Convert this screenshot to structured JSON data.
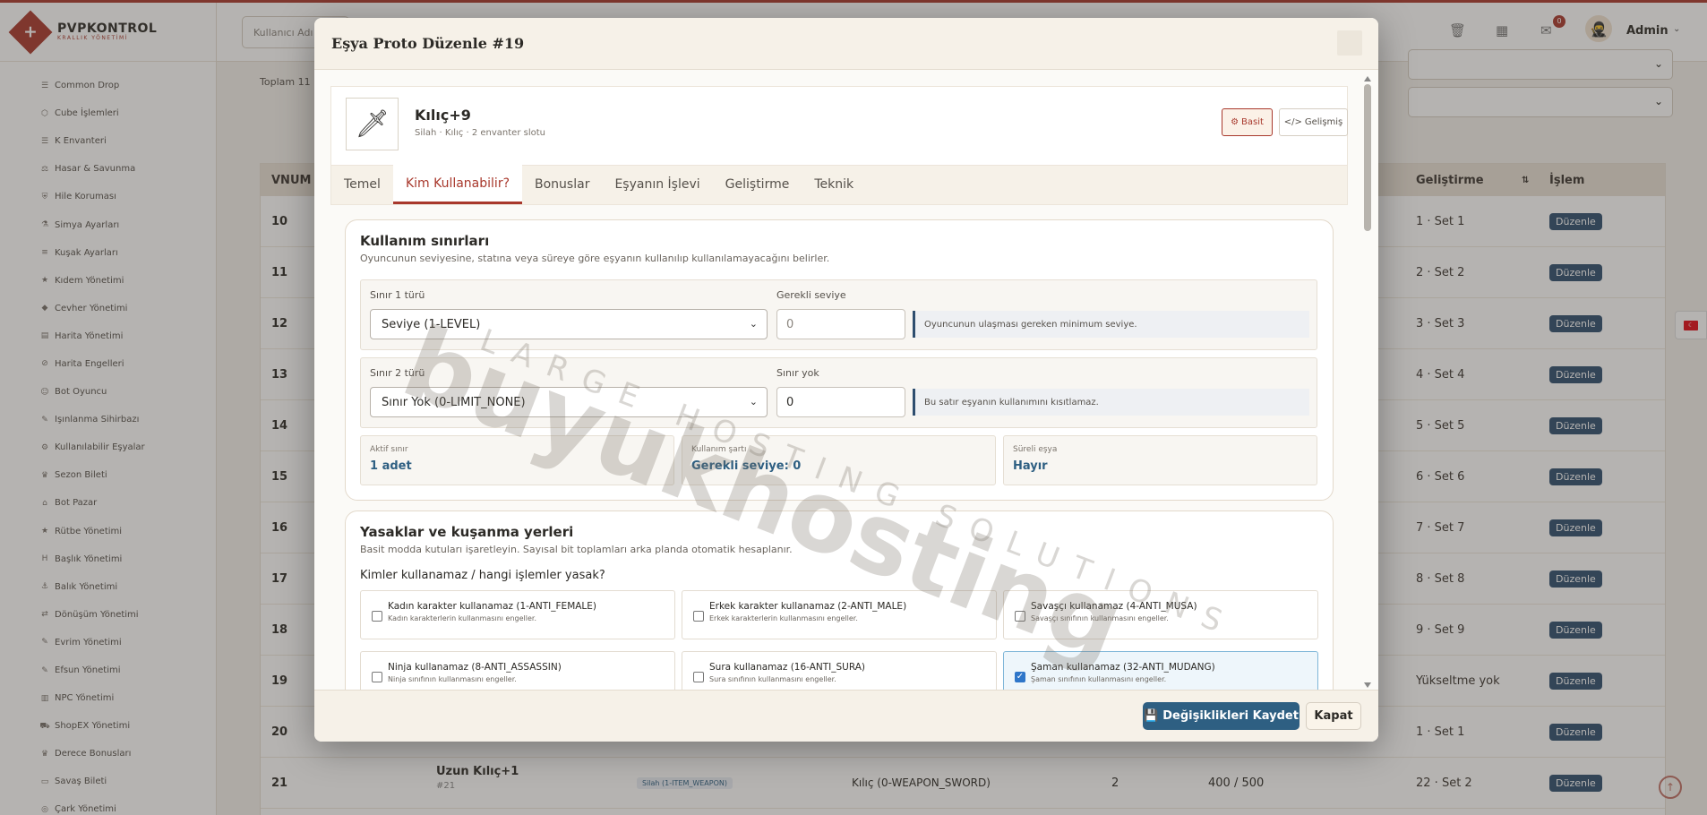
{
  "brand": {
    "title": "PVPKONTROL",
    "subtitle": "KRALLIK YÖNETİMİ",
    "logo_glyph": "+"
  },
  "sidebar": {
    "items": [
      {
        "label": "Common Drop",
        "icon": "list-icon"
      },
      {
        "label": "Cube İşlemleri",
        "icon": "cube-icon"
      },
      {
        "label": "K Envanteri",
        "icon": "list-icon"
      },
      {
        "label": "Hasar & Savunma",
        "icon": "scale-icon"
      },
      {
        "label": "Hile Koruması",
        "icon": "shield-icon"
      },
      {
        "label": "Simya Ayarları",
        "icon": "flask-icon"
      },
      {
        "label": "Kuşak Ayarları",
        "icon": "sliders-icon"
      },
      {
        "label": "Kıdem Yönetimi",
        "icon": "star-icon"
      },
      {
        "label": "Cevher Yönetimi",
        "icon": "gem-icon"
      },
      {
        "label": "Harita Yönetimi",
        "icon": "map-icon"
      },
      {
        "label": "Harita Engelleri",
        "icon": "ban-icon"
      },
      {
        "label": "Bot Oyuncu",
        "icon": "robot-icon"
      },
      {
        "label": "Işınlanma Sihirbazı",
        "icon": "wand-icon"
      },
      {
        "label": "Kullanılabilir Eşyalar",
        "icon": "gears-icon"
      },
      {
        "label": "Sezon Bileti",
        "icon": "trophy-icon"
      },
      {
        "label": "Bot Pazar",
        "icon": "store-icon"
      },
      {
        "label": "Rütbe Yönetimi",
        "icon": "star-icon"
      },
      {
        "label": "Başlık Yönetimi",
        "icon": "heading-icon"
      },
      {
        "label": "Balık Yönetimi",
        "icon": "anchor-icon"
      },
      {
        "label": "Dönüşüm Yönetimi",
        "icon": "shuffle-icon"
      },
      {
        "label": "Evrim Yönetimi",
        "icon": "wand-icon"
      },
      {
        "label": "Efsun Yönetimi",
        "icon": "wand-icon"
      },
      {
        "label": "NPC Yönetimi",
        "icon": "building-icon"
      },
      {
        "label": "ShopEX Yönetimi",
        "icon": "cart-icon"
      },
      {
        "label": "Derece Bonusları",
        "icon": "trophy-icon"
      },
      {
        "label": "Savaş Bileti",
        "icon": "ticket-icon"
      },
      {
        "label": "Çark Yönetimi",
        "icon": "wheel-icon"
      }
    ]
  },
  "topbar": {
    "search_placeholder": "Kullanıcı Adı",
    "notification_count": "0",
    "user_name": "Admin"
  },
  "background": {
    "total_text": "Toplam 11",
    "table_headers": {
      "vnum": "VNUM",
      "gelistirme": "Geliştirme",
      "islem": "İşlem"
    },
    "rows": [
      {
        "vnum": "10",
        "set": "1 · Set 1",
        "edit": "Düzenle"
      },
      {
        "vnum": "11",
        "set": "2 · Set 2",
        "edit": "Düzenle"
      },
      {
        "vnum": "12",
        "set": "3 · Set 3",
        "edit": "Düzenle"
      },
      {
        "vnum": "13",
        "set": "4 · Set 4",
        "edit": "Düzenle"
      },
      {
        "vnum": "14",
        "set": "5 · Set 5",
        "edit": "Düzenle"
      },
      {
        "vnum": "15",
        "set": "6 · Set 6",
        "edit": "Düzenle"
      },
      {
        "vnum": "16",
        "set": "7 · Set 7",
        "edit": "Düzenle"
      },
      {
        "vnum": "17",
        "set": "8 · Set 8",
        "edit": "Düzenle"
      },
      {
        "vnum": "18",
        "set": "9 · Set 9",
        "edit": "Düzenle"
      },
      {
        "vnum": "19",
        "set": "Yükseltme yok",
        "edit": "Düzenle"
      },
      {
        "vnum": "20",
        "set": "1 · Set 1",
        "edit": "Düzenle"
      },
      {
        "vnum": "21",
        "set": "22 · Set 2",
        "edit": "Düzenle"
      }
    ],
    "last_row": {
      "name": "Uzun Kılıç+1",
      "id": "#21",
      "type_badge": "Silah (1-ITEM_WEAPON)",
      "subtype": "Kılıç (0-WEAPON_SWORD)",
      "count": "2",
      "price": "400 / 500"
    }
  },
  "modal": {
    "title": "Eşya Proto Düzenle #19",
    "item": {
      "name": "Kılıç+9",
      "meta": "Silah · Kılıç · 2 envanter slotu",
      "thumb_glyph": "🗡"
    },
    "mode_basit": "Basit",
    "mode_gelismis": "Gelişmiş",
    "tabs": [
      "Temel",
      "Kim Kullanabilir?",
      "Bonuslar",
      "Eşyanın İşlevi",
      "Geliştirme",
      "Teknik"
    ],
    "active_tab": 1,
    "limits": {
      "title": "Kullanım sınırları",
      "desc": "Oyuncunun seviyesine, statına veya süreye göre eşyanın kullanılıp kullanılamayacağını belirler.",
      "row1": {
        "type_label": "Sınır 1 türü",
        "type_value": "Seviye (1-LEVEL)",
        "value_label": "Gerekli seviye",
        "value": "0",
        "hint": "Oyuncunun ulaşması gereken minimum seviye."
      },
      "row2": {
        "type_label": "Sınır 2 türü",
        "type_value": "Sınır Yok (0-LIMIT_NONE)",
        "value_label": "Sınır yok",
        "value": "0",
        "hint": "Bu satır eşyanın kullanımını kısıtlamaz."
      },
      "stats": [
        {
          "label": "Aktif sınır",
          "value": "1 adet"
        },
        {
          "label": "Kullanım şartı",
          "value": "Gerekli seviye: 0"
        },
        {
          "label": "Süreli eşya",
          "value": "Hayır"
        }
      ]
    },
    "bans": {
      "title": "Yasaklar ve kuşanma yerleri",
      "desc": "Basit modda kutuları işaretleyin. Sayısal bit toplamları arka planda otomatik hesaplanır.",
      "question": "Kimler kullanamaz / hangi işlemler yasak?",
      "items": [
        {
          "title": "Kadın karakter kullanamaz (1-ANTI_FEMALE)",
          "desc": "Kadın karakterlerin kullanmasını engeller.",
          "checked": false
        },
        {
          "title": "Erkek karakter kullanamaz (2-ANTI_MALE)",
          "desc": "Erkek karakterlerin kullanmasını engeller.",
          "checked": false
        },
        {
          "title": "Savaşçı kullanamaz (4-ANTI_MUSA)",
          "desc": "Savaşçı sınıfının kullanmasını engeller.",
          "checked": false
        },
        {
          "title": "Ninja kullanamaz (8-ANTI_ASSASSIN)",
          "desc": "Ninja sınıfının kullanmasını engeller.",
          "checked": false
        },
        {
          "title": "Sura kullanamaz (16-ANTI_SURA)",
          "desc": "Sura sınıfının kullanmasını engeller.",
          "checked": false
        },
        {
          "title": "Şaman kullanamaz (32-ANTI_MUDANG)",
          "desc": "Şaman sınıfının kullanmasını engeller.",
          "checked": true
        }
      ]
    },
    "save_label": "Değişiklikleri Kaydet",
    "close_label": "Kapat"
  },
  "watermark": {
    "main": "buyukhosting",
    "sub": "LARGE HOSTING SOLUTIONS"
  },
  "colors": {
    "brand": "#a8382c",
    "primary": "#2e5f82",
    "checkbox": "#2f76c9"
  }
}
